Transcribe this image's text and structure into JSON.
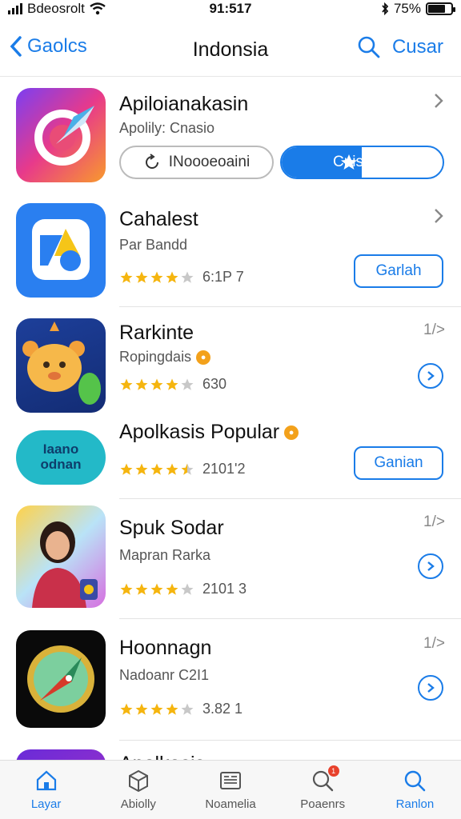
{
  "status_bar": {
    "carrier": "Bdeosrolt",
    "time": "91:517",
    "battery": "75%"
  },
  "nav": {
    "back_label": "Gaolcs",
    "title": "Indonsia",
    "right_label": "Cusar"
  },
  "apps": [
    {
      "name": "Apiloianakasin",
      "subtitle": "Apolily: Cnasio",
      "secondary_button": "INoooeoaini",
      "primary_button": "Cnisanelan"
    },
    {
      "name": "Cahalest",
      "subtitle": "Par Bandd",
      "rating_text": "6:1P 7",
      "button": "Garlah"
    },
    {
      "name": "Rarkinte",
      "subtitle": "Ropingdais",
      "rating_text": "630",
      "rank": "1/>"
    },
    {
      "name": "Apolkasis Popular",
      "icon_text_1": "Iaano",
      "icon_text_2": "odnan",
      "rating_text": "2101'2",
      "button": "Ganian"
    },
    {
      "name": "Spuk Sodar",
      "subtitle": "Mapran Rarka",
      "rating_text": "2101 3",
      "rank": "1/>"
    },
    {
      "name": "Hoonnagn",
      "subtitle": "Nadoanr C2I1",
      "rating_text": "3.82 1",
      "rank": "1/>"
    },
    {
      "name": "Apolkasis"
    }
  ],
  "tabs": [
    {
      "label": "Layar",
      "icon": "home-icon",
      "active": true
    },
    {
      "label": "Abiolly",
      "icon": "box-icon"
    },
    {
      "label": "Noamelia",
      "icon": "news-icon"
    },
    {
      "label": "Poaenrs",
      "icon": "search-badge-icon",
      "badge": "1"
    },
    {
      "label": "Ranlon",
      "icon": "search-icon"
    }
  ],
  "colors": {
    "accent": "#1a7ce8",
    "star": "#f5b50f",
    "badge": "#f3a11b"
  }
}
